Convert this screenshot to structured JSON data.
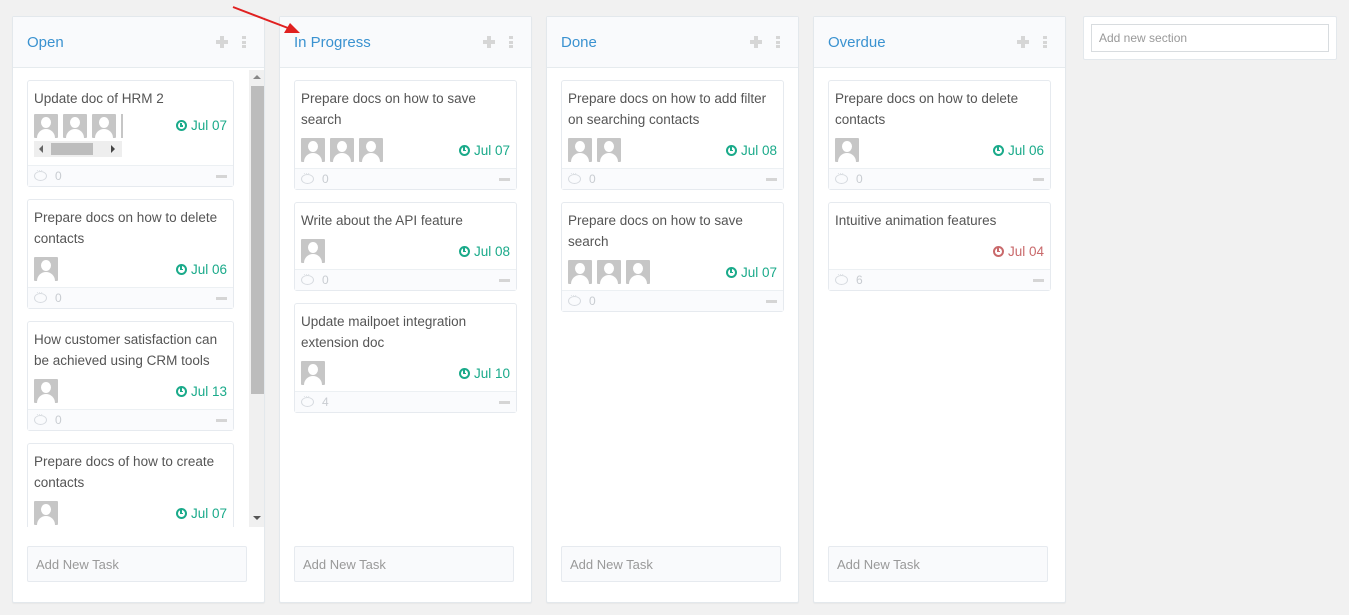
{
  "colors": {
    "section_title": "#3a92d0",
    "due_ok": "#1aaa8a",
    "due_overdue": "#c9696b",
    "annotation_arrow": "#e02020"
  },
  "new_section": {
    "placeholder": "Add new section"
  },
  "sections": [
    {
      "title": "Open",
      "add_task_placeholder": "Add New Task",
      "tasks": [
        {
          "title": "Update doc of HRM 2",
          "assignees": 3,
          "due": "Jul 07",
          "overdue": false,
          "comments": "0"
        },
        {
          "title": "Prepare docs on how to delete contacts",
          "assignees": 1,
          "due": "Jul 06",
          "overdue": false,
          "comments": "0"
        },
        {
          "title": "How customer satisfaction can be achieved using CRM tools",
          "assignees": 1,
          "due": "Jul 13",
          "overdue": false,
          "comments": "0"
        },
        {
          "title": "Prepare docs of how to create contacts",
          "assignees": 1,
          "due": "Jul 07",
          "overdue": false,
          "comments": ""
        }
      ]
    },
    {
      "title": "In Progress",
      "add_task_placeholder": "Add New Task",
      "tasks": [
        {
          "title": "Prepare docs on how to save search",
          "assignees": 3,
          "due": "Jul 07",
          "overdue": false,
          "comments": "0"
        },
        {
          "title": "Write about the API feature",
          "assignees": 1,
          "due": "Jul 08",
          "overdue": false,
          "comments": "0"
        },
        {
          "title": "Update mailpoet integration extension doc",
          "assignees": 1,
          "due": "Jul 10",
          "overdue": false,
          "comments": "4"
        }
      ]
    },
    {
      "title": "Done",
      "add_task_placeholder": "Add New Task",
      "tasks": [
        {
          "title": "Prepare docs on how to add filter on searching contacts",
          "assignees": 2,
          "due": "Jul 08",
          "overdue": false,
          "comments": "0"
        },
        {
          "title": "Prepare docs on how to save search",
          "assignees": 3,
          "due": "Jul 07",
          "overdue": false,
          "comments": "0"
        }
      ]
    },
    {
      "title": "Overdue",
      "add_task_placeholder": "Add New Task",
      "tasks": [
        {
          "title": "Prepare docs on how to delete contacts",
          "assignees": 1,
          "due": "Jul 06",
          "overdue": false,
          "comments": "0"
        },
        {
          "title": "Intuitive animation features",
          "assignees": 0,
          "due": "Jul 04",
          "overdue": true,
          "comments": "6"
        }
      ]
    }
  ]
}
